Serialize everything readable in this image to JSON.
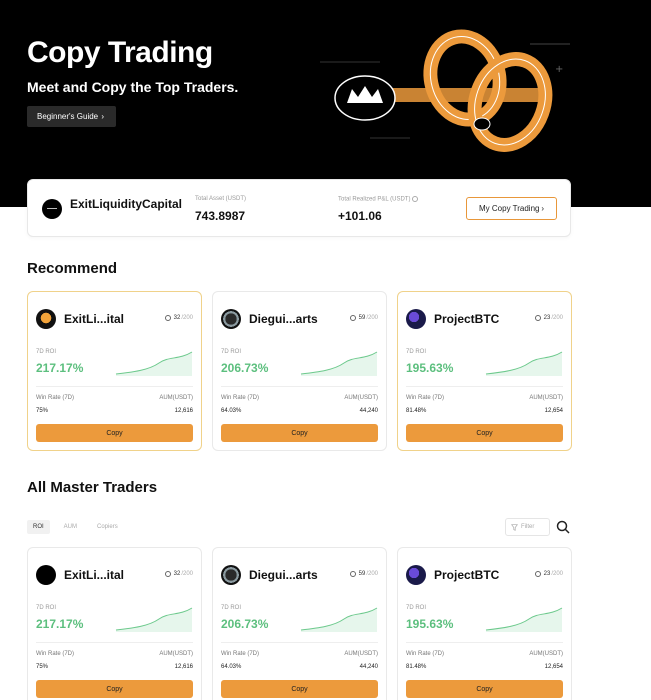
{
  "hero": {
    "title": "Copy Trading",
    "subtitle": "Meet and Copy the Top Traders.",
    "guide_label": "Beginner's Guide"
  },
  "account": {
    "name": "ExitLiquidityCapital",
    "total_asset_label": "Total Asset (USDT)",
    "total_asset_value": "743.8987",
    "pnl_label": "Total Realized P&L (USDT)",
    "pnl_value": "+101.06",
    "my_copy_label": "My Copy Trading"
  },
  "recommend": {
    "title": "Recommend"
  },
  "all_traders": {
    "title": "All Master Traders",
    "tabs": [
      "ROI",
      "AUM",
      "Copiers"
    ],
    "active_tab": "ROI",
    "filter_placeholder": "Filter"
  },
  "labels": {
    "roi": "7D ROI",
    "win_rate": "Win Rate (7D)",
    "aum": "AUM(USDT)",
    "copy": "Copy"
  },
  "recommend_cards": [
    {
      "name": "ExitLi...ital",
      "followers": "32",
      "max": "/200",
      "roi": "217.17%",
      "win_rate": "75%",
      "aum": "12,616"
    },
    {
      "name": "Diegui...arts",
      "followers": "59",
      "max": "/200",
      "roi": "206.73%",
      "win_rate": "64.03%",
      "aum": "44,240"
    },
    {
      "name": "ProjectBTC",
      "followers": "23",
      "max": "/200",
      "roi": "195.63%",
      "win_rate": "81.48%",
      "aum": "12,654"
    }
  ],
  "master_cards": [
    {
      "name": "ExitLi...ital",
      "followers": "32",
      "max": "/200",
      "roi": "217.17%",
      "win_rate": "75%",
      "aum": "12,616"
    },
    {
      "name": "Diegui...arts",
      "followers": "59",
      "max": "/200",
      "roi": "206.73%",
      "win_rate": "64.03%",
      "aum": "44,240"
    },
    {
      "name": "ProjectBTC",
      "followers": "23",
      "max": "/200",
      "roi": "195.63%",
      "win_rate": "81.48%",
      "aum": "12,654"
    }
  ],
  "colors": {
    "accent": "#ec9a3c",
    "positive": "#5cbf7e",
    "hero_bg": "#000000"
  }
}
